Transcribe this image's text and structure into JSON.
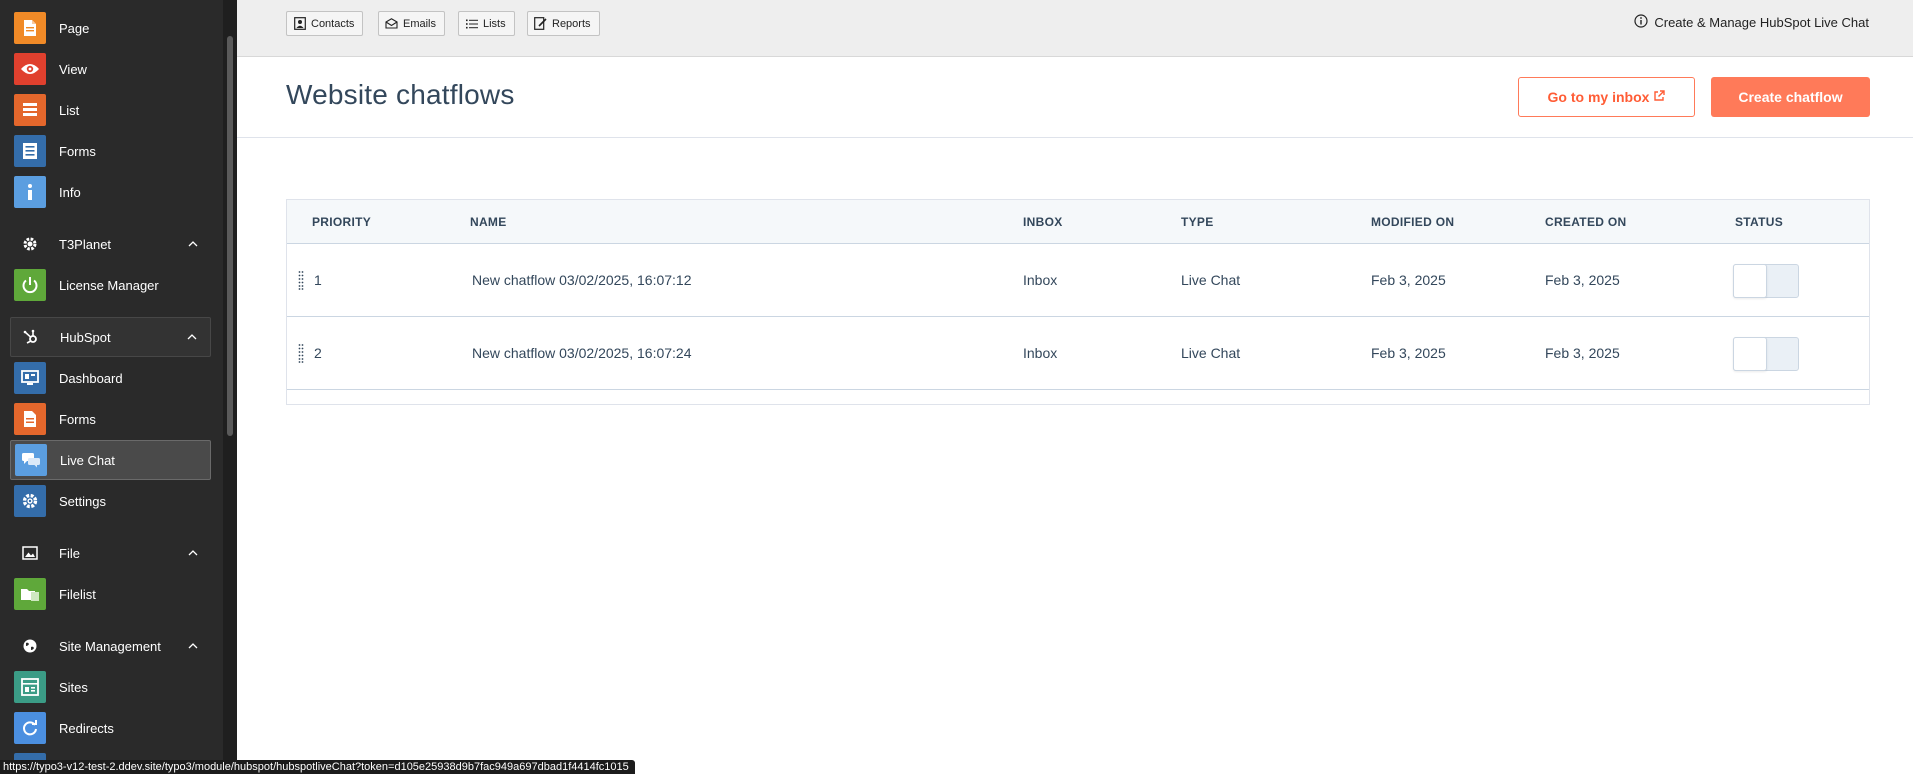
{
  "sidebar": {
    "items": [
      {
        "label": "Page",
        "icon": "page-icon",
        "color": "#f08a27"
      },
      {
        "label": "View",
        "icon": "eye-icon",
        "color": "#e0402e"
      },
      {
        "label": "List",
        "icon": "list-icon",
        "color": "#e4672c"
      },
      {
        "label": "Forms",
        "icon": "form-icon",
        "color": "#346daa"
      },
      {
        "label": "Info",
        "icon": "info-icon",
        "color": "#5b9ee0"
      }
    ],
    "groups": {
      "t3planet": {
        "label": "T3Planet",
        "icon": "gear-icon"
      },
      "hubspot": {
        "label": "HubSpot",
        "icon": "hubspot-icon"
      },
      "file": {
        "label": "File",
        "icon": "image-icon"
      },
      "site_management": {
        "label": "Site Management",
        "icon": "globe-icon"
      }
    },
    "t3planet_items": [
      {
        "label": "License Manager",
        "icon": "power-icon",
        "color": "#5fa83a"
      }
    ],
    "hubspot_items": [
      {
        "label": "Dashboard",
        "icon": "dashboard-icon",
        "color": "#346daa"
      },
      {
        "label": "Forms",
        "icon": "form-icon",
        "color": "#e4672c"
      },
      {
        "label": "Live Chat",
        "icon": "chat-icon",
        "color": "#5b9ee0"
      },
      {
        "label": "Settings",
        "icon": "gear-icon",
        "color": "#346daa"
      }
    ],
    "file_items": [
      {
        "label": "Filelist",
        "icon": "folder-icon",
        "color": "#5fa83a"
      }
    ],
    "site_items": [
      {
        "label": "Sites",
        "icon": "sites-icon",
        "color": "#3b9c86"
      },
      {
        "label": "Redirects",
        "icon": "redirect-icon",
        "color": "#4b8fe0"
      }
    ]
  },
  "toolbar": {
    "buttons": [
      {
        "label": "Contacts",
        "icon": "contacts-icon"
      },
      {
        "label": "Emails",
        "icon": "email-icon"
      },
      {
        "label": "Lists",
        "icon": "list-icon"
      },
      {
        "label": "Reports",
        "icon": "report-icon"
      }
    ],
    "info_text": "Create & Manage HubSpot Live Chat"
  },
  "header": {
    "title": "Website chatflows",
    "inbox_button": "Go to my inbox",
    "create_button": "Create chatflow",
    "accent_color": "#ff7a59"
  },
  "table": {
    "columns": [
      "PRIORITY",
      "NAME",
      "INBOX",
      "TYPE",
      "MODIFIED ON",
      "CREATED ON",
      "STATUS"
    ],
    "rows": [
      {
        "priority": "1",
        "name": "New chatflow 03/02/2025, 16:07:12",
        "inbox": "Inbox",
        "type": "Live Chat",
        "modified": "Feb 3, 2025",
        "created": "Feb 3, 2025",
        "status": "off"
      },
      {
        "priority": "2",
        "name": "New chatflow 03/02/2025, 16:07:24",
        "inbox": "Inbox",
        "type": "Live Chat",
        "modified": "Feb 3, 2025",
        "created": "Feb 3, 2025",
        "status": "off"
      }
    ]
  },
  "status_bar": {
    "url": "https://typo3-v12-test-2.ddev.site/typo3/module/hubspot/hubspotliveChat?token=d105e25938d9b7fac949a697dbad1f4414fc1015"
  }
}
